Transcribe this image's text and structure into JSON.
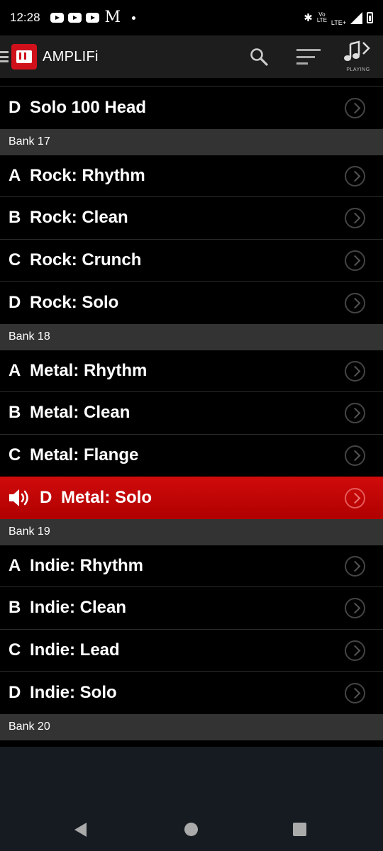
{
  "status_bar": {
    "time": "12:28",
    "notification_icons": [
      "youtube-icon",
      "youtube-icon",
      "youtube-icon",
      "gmail-icon",
      "dot-icon"
    ],
    "volte_top": "Vo",
    "volte_bottom": "LTE",
    "lte_label": "LTE+"
  },
  "app_bar": {
    "title": "AMPLIFi",
    "playing_label": "PLAYING"
  },
  "presets": {
    "top": [
      {
        "letter": "D",
        "name": "Solo 100 Head"
      }
    ],
    "banks": [
      {
        "label": "Bank 17",
        "items": [
          {
            "letter": "A",
            "name": "Rock: Rhythm"
          },
          {
            "letter": "B",
            "name": "Rock: Clean"
          },
          {
            "letter": "C",
            "name": "Rock: Crunch"
          },
          {
            "letter": "D",
            "name": "Rock: Solo"
          }
        ]
      },
      {
        "label": "Bank 18",
        "items": [
          {
            "letter": "A",
            "name": "Metal: Rhythm"
          },
          {
            "letter": "B",
            "name": "Metal: Clean"
          },
          {
            "letter": "C",
            "name": "Metal: Flange"
          },
          {
            "letter": "D",
            "name": "Metal: Solo",
            "active": true
          }
        ]
      },
      {
        "label": "Bank 19",
        "items": [
          {
            "letter": "A",
            "name": "Indie: Rhythm"
          },
          {
            "letter": "B",
            "name": "Indie: Clean"
          },
          {
            "letter": "C",
            "name": "Indie: Lead"
          },
          {
            "letter": "D",
            "name": "Indie: Solo"
          }
        ]
      },
      {
        "label": "Bank 20",
        "items": []
      }
    ]
  },
  "colors": {
    "active_row": "#c80606",
    "bank_header": "#333333",
    "app_bar": "#1d1d1d"
  }
}
